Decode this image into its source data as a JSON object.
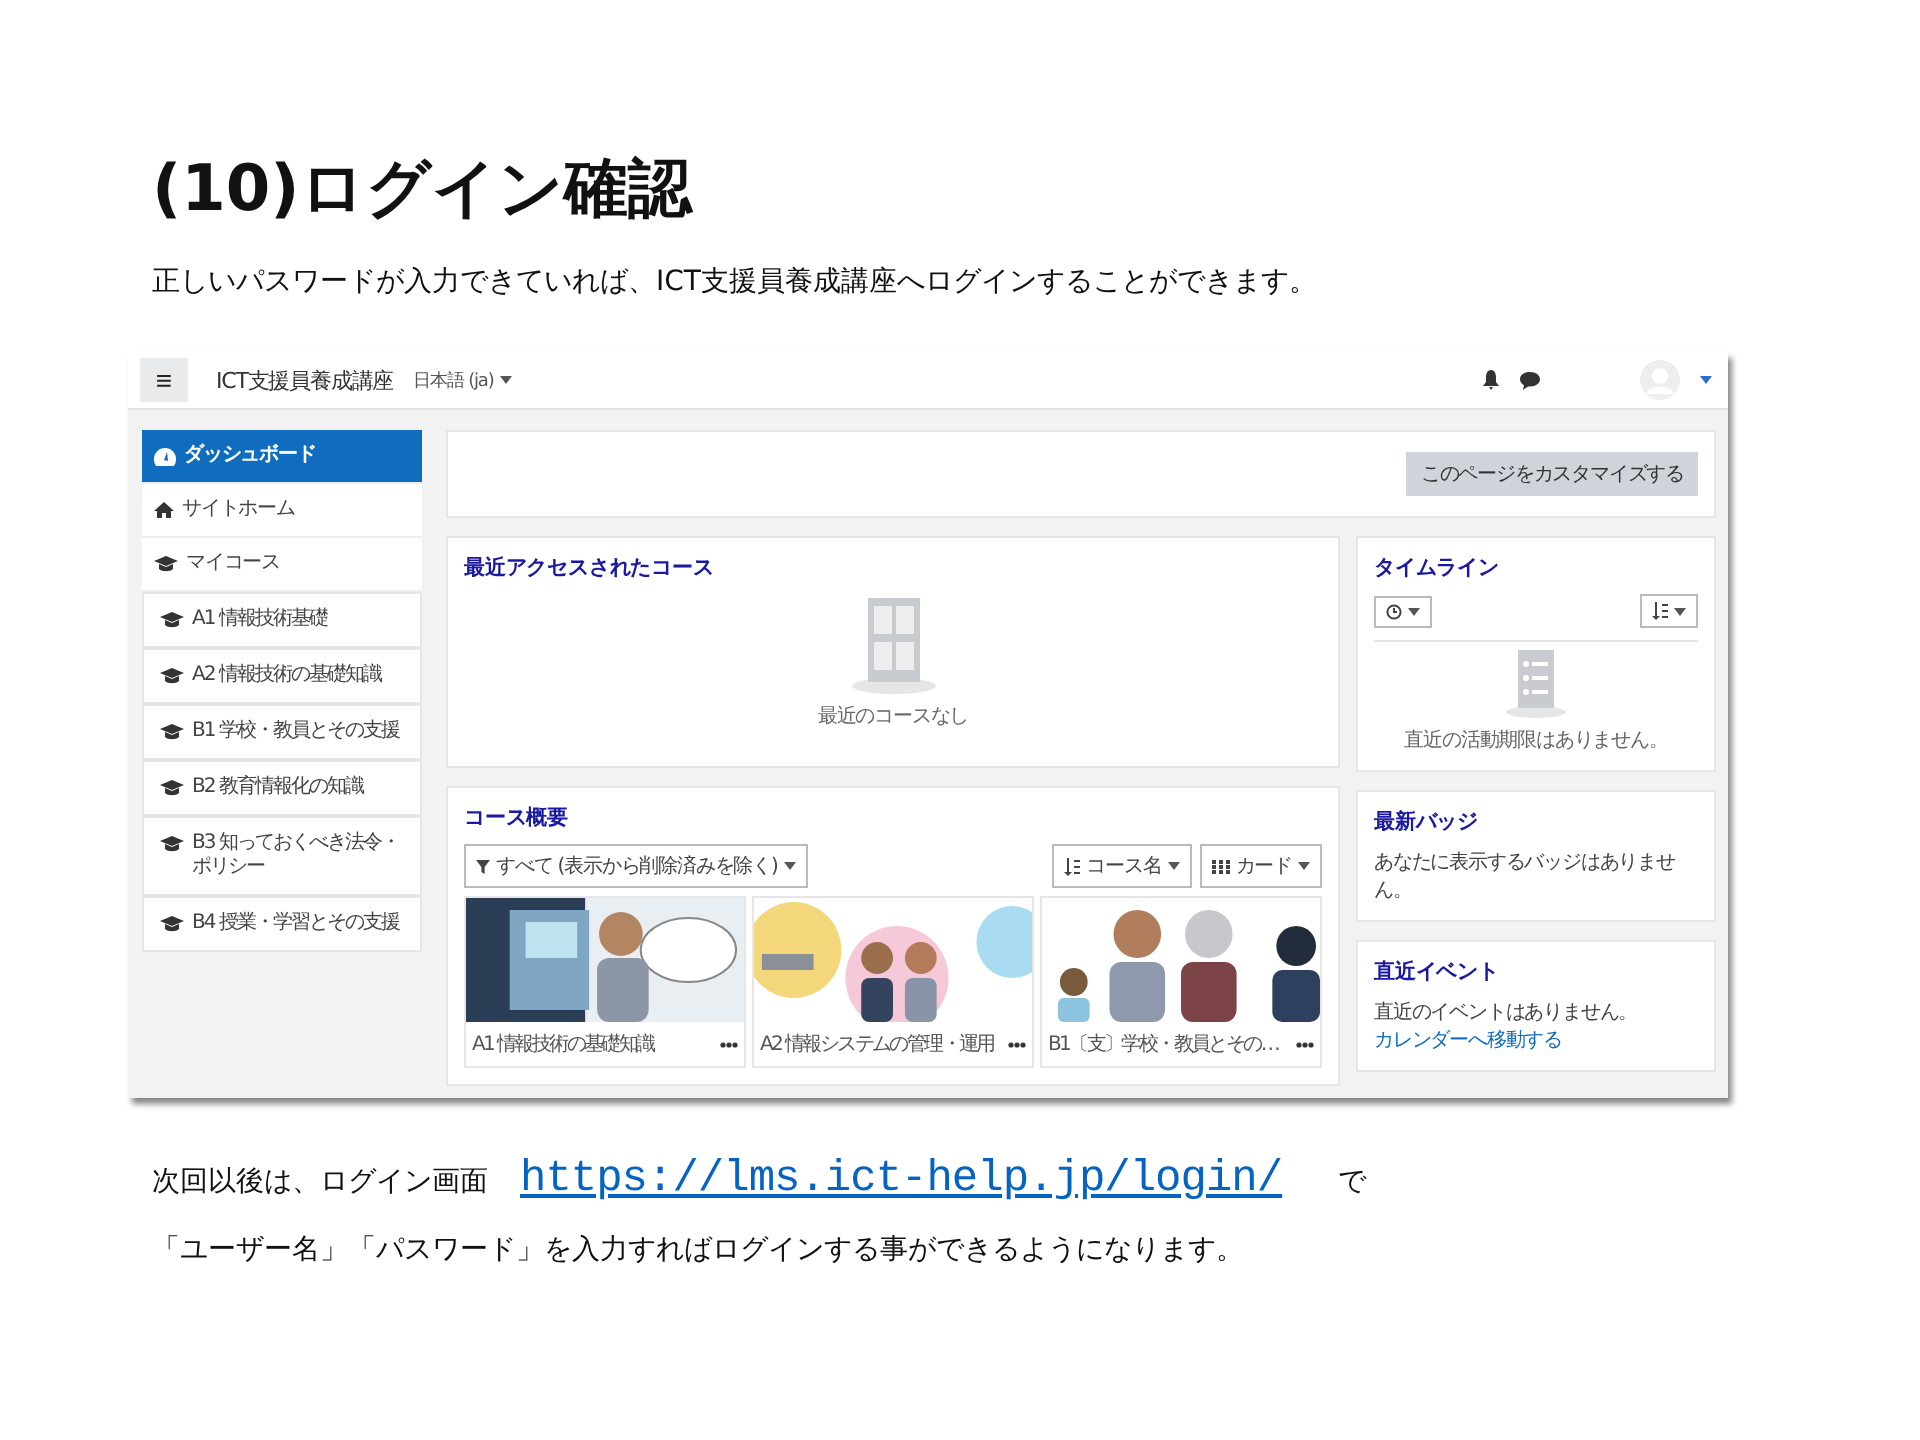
{
  "slide": {
    "title": "(10)ログイン確認",
    "intro": "正しいパスワードが入力できていれば、ICT支援員養成講座へログインすることができます。",
    "next_before": "次回以後は、ログイン画面",
    "next_link": "https://lms.ict-help.jp/login/",
    "next_after": "で",
    "outro": "「ユーザー名」「パスワード」を入力すればログインする事ができるようになります。"
  },
  "screenshot": {
    "navbar": {
      "menu": "≡",
      "site_name": "ICT支援員養成講座",
      "language": "日本語 (ja)"
    },
    "sidebar": {
      "items": [
        {
          "label": "ダッシュボード",
          "kind": "dashboard",
          "selected": true
        },
        {
          "label": "サイトホーム",
          "kind": "home",
          "selected": false
        },
        {
          "label": "マイコース",
          "kind": "courses",
          "selected": false
        },
        {
          "label": "A1 情報技術基礎",
          "kind": "course",
          "selected": false
        },
        {
          "label": "A2 情報技術の基礎知識",
          "kind": "course",
          "selected": false
        },
        {
          "label": "B1 学校・教員とその支援",
          "kind": "course",
          "selected": false
        },
        {
          "label": "B2 教育情報化の知識",
          "kind": "course",
          "selected": false
        },
        {
          "label": "B3 知っておくべき法令・ポリシー",
          "kind": "course",
          "selected": false
        },
        {
          "label": "B4 授業・学習とその支援",
          "kind": "course",
          "selected": false
        }
      ]
    },
    "customize_button": "このページをカスタマイズする",
    "recent": {
      "title": "最近アクセスされたコース",
      "empty_text": "最近のコースなし"
    },
    "overview": {
      "title": "コース概要",
      "filter": "すべて (表示から削除済みを除く)",
      "sort": "コース名",
      "view": "カード",
      "courses": [
        {
          "name": "A1 情報技術の基礎知識",
          "kind": "picture"
        },
        {
          "name": "A2 情報システムの管理・運用",
          "kind": "picture"
        },
        {
          "name": "B1〔支〕学校・教員とその…",
          "kind": "picture"
        }
      ]
    },
    "timeline": {
      "title": "タイムライン",
      "empty_text": "直近の活動期限はありません。"
    },
    "badges": {
      "title": "最新バッジ",
      "text": "あなたに表示するバッジはありません。"
    },
    "events": {
      "title": "直近イベント",
      "text": "直近のイベントはありません。",
      "link": "カレンダーへ移動する"
    }
  }
}
